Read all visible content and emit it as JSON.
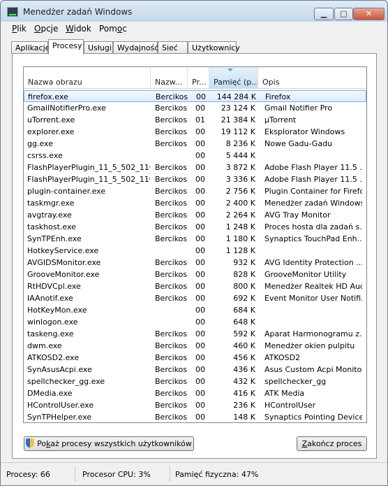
{
  "window": {
    "title": "Menedżer zadań Windows",
    "btn_min": "▁",
    "btn_max": "□",
    "btn_close": "✕"
  },
  "menu": [
    {
      "accel": "P",
      "rest": "lik"
    },
    {
      "accel": "O",
      "rest": "pcje"
    },
    {
      "accel": "W",
      "rest": "idok"
    },
    {
      "pre": "Pom",
      "accel": "o",
      "rest": "c"
    }
  ],
  "tabs": [
    "Aplikacje",
    "Procesy",
    "Usługi",
    "Wydajność",
    "Sieć",
    "Użytkownicy"
  ],
  "active_tab": "Procesy",
  "columns": [
    "Nazwa obrazu",
    "Nazw...",
    "Pr...",
    "Pamięć (p...",
    "Opis"
  ],
  "rows": [
    [
      "firefox.exe",
      "Bercikos",
      "00",
      "144 284 K",
      "Firefox"
    ],
    [
      "GmailNotifierPro.exe",
      "Bercikos",
      "00",
      "23 124 K",
      "Gmail Notifier Pro"
    ],
    [
      "uTorrent.exe",
      "Bercikos",
      "01",
      "21 384 K",
      "µTorrent"
    ],
    [
      "explorer.exe",
      "Bercikos",
      "00",
      "19 112 K",
      "Eksplorator Windows"
    ],
    [
      "gg.exe",
      "Bercikos",
      "00",
      "8 236 K",
      "Nowe Gadu-Gadu"
    ],
    [
      "csrss.exe",
      "",
      "00",
      "5 444 K",
      ""
    ],
    [
      "FlashPlayerPlugin_11_5_502_110...",
      "Bercikos",
      "00",
      "3 872 K",
      "Adobe Flash Player 11.5 ..."
    ],
    [
      "FlashPlayerPlugin_11_5_502_110...",
      "Bercikos",
      "00",
      "3 336 K",
      "Adobe Flash Player 11.5 ..."
    ],
    [
      "plugin-container.exe",
      "Bercikos",
      "00",
      "2 756 K",
      "Plugin Container for Firefox"
    ],
    [
      "taskmgr.exe",
      "Bercikos",
      "00",
      "2 400 K",
      "Menedżer zadań Windows"
    ],
    [
      "avgtray.exe",
      "Bercikos",
      "00",
      "2 264 K",
      "AVG Tray Monitor"
    ],
    [
      "taskhost.exe",
      "Bercikos",
      "00",
      "1 248 K",
      "Proces hosta dla zadań s..."
    ],
    [
      "SynTPEnh.exe",
      "Bercikos",
      "00",
      "1 180 K",
      "Synaptics TouchPad Enh..."
    ],
    [
      "HotkeyService.exe",
      "",
      "00",
      "1 128 K",
      ""
    ],
    [
      "AVGIDSMonitor.exe",
      "Bercikos",
      "00",
      "932 K",
      "AVG Identity Protection ..."
    ],
    [
      "GrooveMonitor.exe",
      "Bercikos",
      "00",
      "828 K",
      "GrooveMonitor Utility"
    ],
    [
      "RtHDVCpl.exe",
      "Bercikos",
      "00",
      "800 K",
      "Menedżer Realtek HD Audio"
    ],
    [
      "IAAnotif.exe",
      "Bercikos",
      "00",
      "692 K",
      "Event Monitor User Notifi..."
    ],
    [
      "HotKeyMon.exe",
      "",
      "00",
      "684 K",
      ""
    ],
    [
      "winlogon.exe",
      "",
      "00",
      "648 K",
      ""
    ],
    [
      "taskeng.exe",
      "Bercikos",
      "00",
      "592 K",
      "Aparat Harmonogramu z..."
    ],
    [
      "dwm.exe",
      "Bercikos",
      "00",
      "460 K",
      "Menedżer okien pulpitu"
    ],
    [
      "ATKOSD2.exe",
      "Bercikos",
      "00",
      "456 K",
      "ATKOSD2"
    ],
    [
      "SynAsusAcpi.exe",
      "Bercikos",
      "00",
      "436 K",
      "Asus Custom Acpi Monito..."
    ],
    [
      "spellchecker_gg.exe",
      "Bercikos",
      "00",
      "432 K",
      "spellchecker_gg"
    ],
    [
      "DMedia.exe",
      "Bercikos",
      "00",
      "416 K",
      "ATK Media"
    ],
    [
      "HControlUser.exe",
      "Bercikos",
      "00",
      "236 K",
      "HControlUser"
    ],
    [
      "SynTPHelper.exe",
      "Bercikos",
      "00",
      "148 K",
      "Synaptics Pointing Device..."
    ]
  ],
  "buttons": {
    "show_all": {
      "pre": "Po",
      "accel": "k",
      "rest": "aż procesy wszystkich użytkowników"
    },
    "end_process": {
      "pre": "",
      "accel": "Z",
      "rest": "akończ proces"
    }
  },
  "status": {
    "processes": "Procesy: 66",
    "cpu": "Procesor CPU: 3%",
    "memory": "Pamięć fizyczna: 47%"
  }
}
